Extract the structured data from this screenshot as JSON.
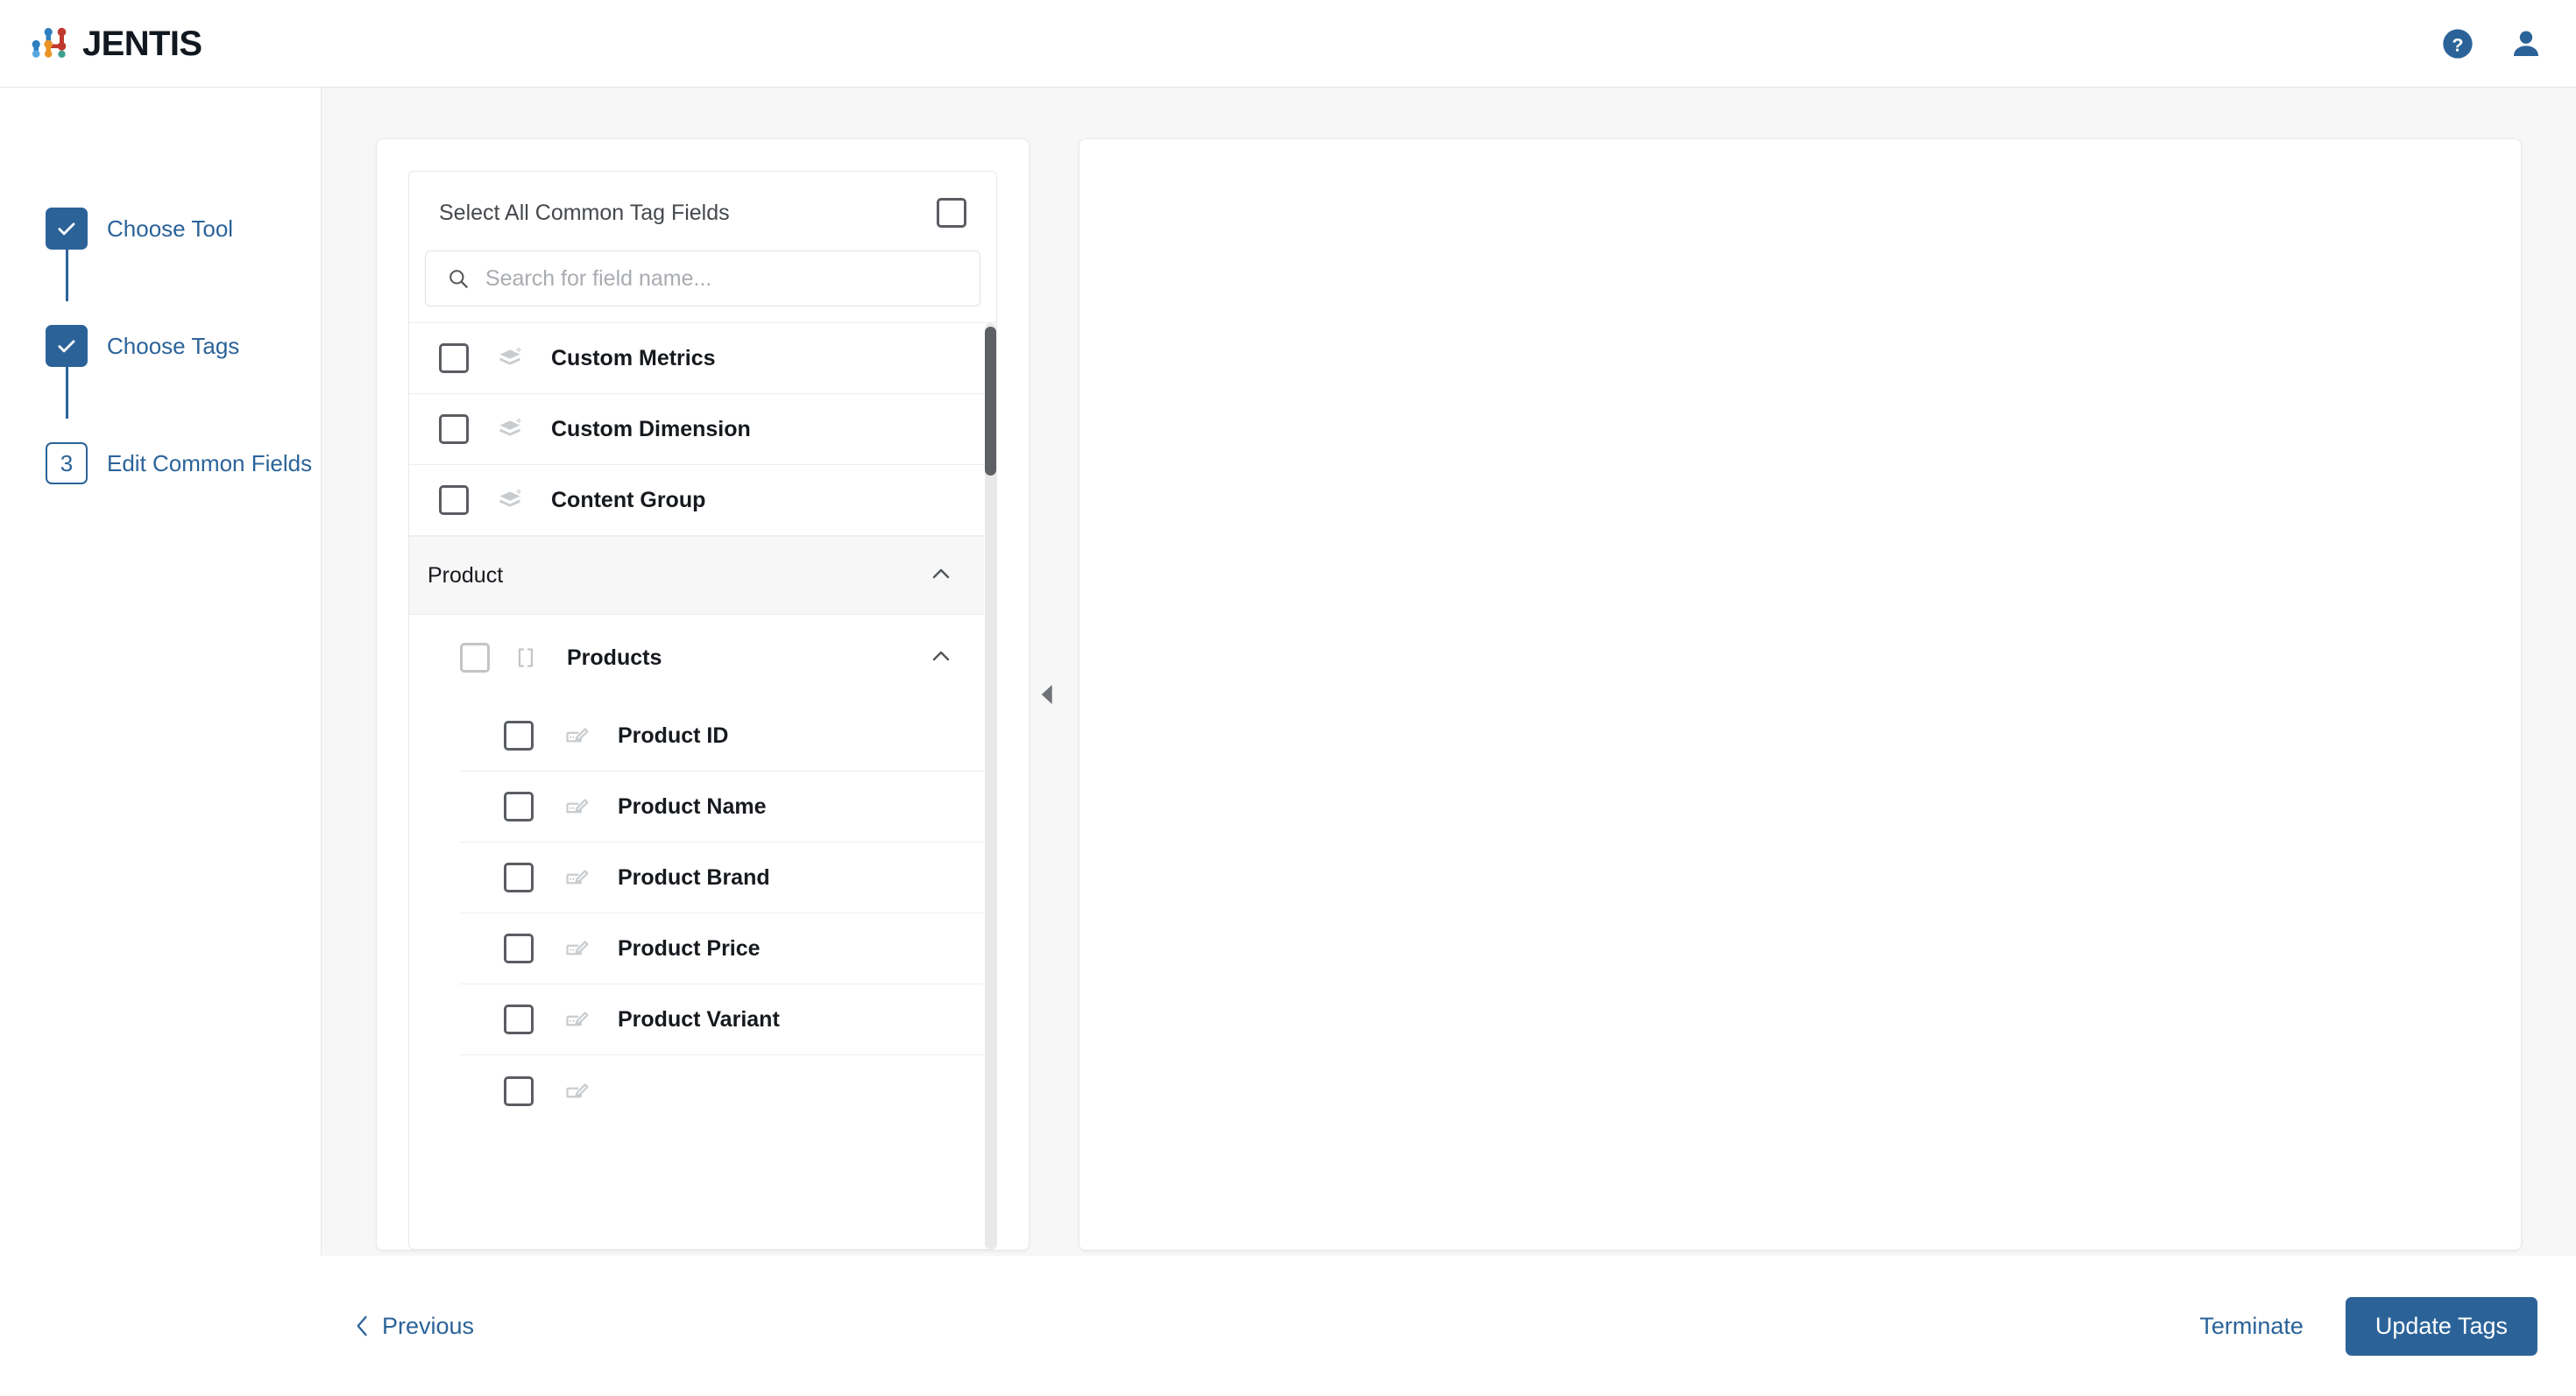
{
  "app": {
    "brand_name": "JENTIS"
  },
  "topbar": {
    "help_icon": "help-circle-icon",
    "account_icon": "user-avatar-icon"
  },
  "stepper": {
    "steps": [
      {
        "badge": "✓",
        "label": "Choose Tool",
        "state": "done"
      },
      {
        "badge": "✓",
        "label": "Choose Tags",
        "state": "done"
      },
      {
        "badge": "3",
        "label": "Edit Common Fields",
        "state": "current"
      }
    ]
  },
  "picker": {
    "select_all_label": "Select All Common Tag Fields",
    "select_all_checked": false,
    "search": {
      "placeholder": "Search for field name...",
      "value": "",
      "icon": "search-icon"
    },
    "top_fields": [
      {
        "label": "Custom Metrics",
        "icon": "layers-plus-icon",
        "checked": false
      },
      {
        "label": "Custom Dimension",
        "icon": "layers-plus-icon",
        "checked": false
      },
      {
        "label": "Content Group",
        "icon": "layers-plus-icon",
        "checked": false
      }
    ],
    "group": {
      "title": "Product",
      "expanded": true,
      "chevron": "chevron-up-icon",
      "array_node": {
        "label": "Products",
        "icon": "array-brackets-icon",
        "checked": false,
        "expanded": true,
        "chevron": "chevron-up-icon",
        "fields": [
          {
            "label": "Product ID",
            "icon": "edit-field-icon",
            "checked": false
          },
          {
            "label": "Product Name",
            "icon": "edit-field-icon",
            "checked": false
          },
          {
            "label": "Product Brand",
            "icon": "edit-field-icon",
            "checked": false
          },
          {
            "label": "Product Price",
            "icon": "edit-field-icon",
            "checked": false
          },
          {
            "label": "Product Variant",
            "icon": "edit-field-icon",
            "checked": false
          }
        ]
      }
    },
    "scrollbar": {
      "thumb_top_pct": 1,
      "thumb_height_pct": 23
    }
  },
  "collapse_handle": {
    "icon": "triangle-left-icon"
  },
  "footer": {
    "previous_label": "Previous",
    "previous_icon": "chevron-left-icon",
    "terminate_label": "Terminate",
    "update_label": "Update Tags"
  },
  "colors": {
    "brand_blue": "#2b6399",
    "logo_blue": "#2e7fc0",
    "logo_orange": "#eb9423",
    "logo_red": "#c0392e",
    "logo_teal": "#3fa08f",
    "page_bg": "#f7f7f8",
    "text_dark": "#16191d",
    "text_muted": "#a9acb0"
  }
}
